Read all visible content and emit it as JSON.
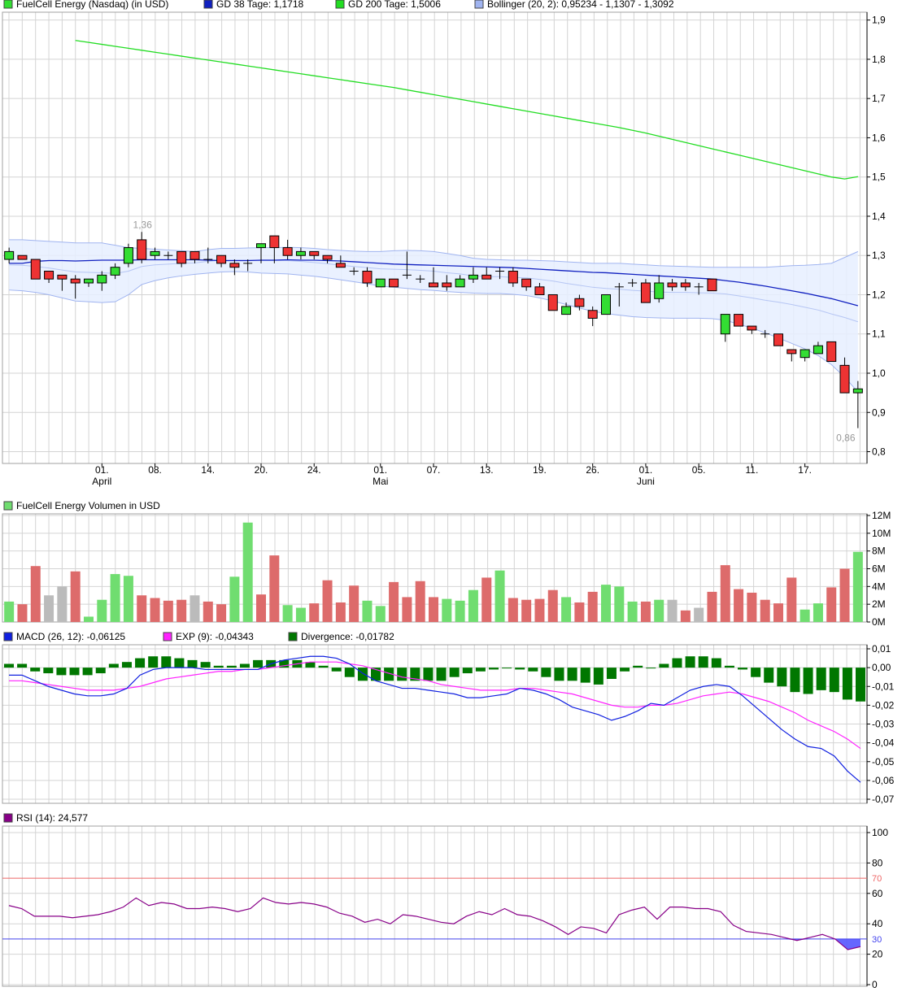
{
  "colors": {
    "grid": "#d4d4d4",
    "frame": "#a0a0a0",
    "up": "#33dd33",
    "down": "#ee3333",
    "gd38": "#1020c0",
    "gd200": "#22dd22",
    "band_fill": "#e6efff",
    "band_line": "#a0b4f0",
    "vol_up": "#70dd70",
    "vol_down": "#dd6b6b",
    "vol_neutral": "#bbbbbb",
    "macd": "#1020e0",
    "exp": "#ff22ff",
    "divergence": "#007700",
    "rsi": "#880088",
    "rsi_70": "#ee6666",
    "rsi_30": "#4444ee",
    "rsi_fill": "#5555ff"
  },
  "chart_data": [
    {
      "id": "price",
      "type": "candlestick",
      "legend": [
        {
          "label": "FuelCell Energy (Nasdaq) (in USD)",
          "color": "#33dd33"
        },
        {
          "label": "GD 38 Tage: 1,1718",
          "color": "#1020c0"
        },
        {
          "label": "GD 200 Tage: 1,5006",
          "color": "#22dd22"
        },
        {
          "label": "Bollinger (20, 2): 0,95234 - 1,1307 - 1,3092",
          "color": "#a0b4f0"
        }
      ],
      "ylim": [
        0.77,
        1.92
      ],
      "y_ticks": [
        "0,8",
        "0,9",
        "1,0",
        "1,1",
        "1,2",
        "1,3",
        "1,4",
        "1,5",
        "1,6",
        "1,7",
        "1,8",
        "1,9"
      ],
      "x_ticks": [
        "01.",
        "08.",
        "14.",
        "20.",
        "24.",
        "01.",
        "07.",
        "13.",
        "19.",
        "26.",
        "01.",
        "05.",
        "11.",
        "17."
      ],
      "x_month_labels": [
        "April",
        "Mai",
        "Juni"
      ],
      "annotations": [
        "1,36",
        "0,86"
      ],
      "candles": [
        [
          1.29,
          1.32,
          1.28,
          1.31
        ],
        [
          1.3,
          1.3,
          1.29,
          1.29
        ],
        [
          1.29,
          1.29,
          1.24,
          1.24
        ],
        [
          1.26,
          1.26,
          1.23,
          1.24
        ],
        [
          1.25,
          1.25,
          1.21,
          1.24
        ],
        [
          1.24,
          1.25,
          1.19,
          1.23
        ],
        [
          1.23,
          1.24,
          1.22,
          1.24
        ],
        [
          1.23,
          1.26,
          1.21,
          1.25
        ],
        [
          1.25,
          1.28,
          1.24,
          1.27
        ],
        [
          1.28,
          1.33,
          1.27,
          1.32
        ],
        [
          1.34,
          1.36,
          1.28,
          1.29
        ],
        [
          1.3,
          1.32,
          1.29,
          1.31
        ],
        [
          1.3,
          1.31,
          1.29,
          1.3
        ],
        [
          1.31,
          1.31,
          1.27,
          1.28
        ],
        [
          1.31,
          1.31,
          1.28,
          1.29
        ],
        [
          1.29,
          1.32,
          1.28,
          1.29
        ],
        [
          1.3,
          1.3,
          1.27,
          1.28
        ],
        [
          1.28,
          1.29,
          1.25,
          1.27
        ],
        [
          1.28,
          1.29,
          1.26,
          1.28
        ],
        [
          1.32,
          1.33,
          1.28,
          1.33
        ],
        [
          1.35,
          1.35,
          1.28,
          1.32
        ],
        [
          1.32,
          1.34,
          1.29,
          1.3
        ],
        [
          1.3,
          1.32,
          1.29,
          1.31
        ],
        [
          1.31,
          1.31,
          1.29,
          1.3
        ],
        [
          1.3,
          1.3,
          1.28,
          1.29
        ],
        [
          1.28,
          1.3,
          1.27,
          1.27
        ],
        [
          1.26,
          1.27,
          1.25,
          1.26
        ],
        [
          1.26,
          1.27,
          1.22,
          1.23
        ],
        [
          1.22,
          1.24,
          1.22,
          1.24
        ],
        [
          1.24,
          1.24,
          1.22,
          1.22
        ],
        [
          1.25,
          1.31,
          1.24,
          1.25
        ],
        [
          1.24,
          1.25,
          1.23,
          1.24
        ],
        [
          1.23,
          1.27,
          1.22,
          1.22
        ],
        [
          1.23,
          1.25,
          1.21,
          1.22
        ],
        [
          1.22,
          1.25,
          1.22,
          1.24
        ],
        [
          1.24,
          1.27,
          1.23,
          1.25
        ],
        [
          1.25,
          1.27,
          1.24,
          1.24
        ],
        [
          1.26,
          1.27,
          1.24,
          1.26
        ],
        [
          1.26,
          1.27,
          1.22,
          1.23
        ],
        [
          1.24,
          1.24,
          1.21,
          1.22
        ],
        [
          1.22,
          1.23,
          1.2,
          1.2
        ],
        [
          1.2,
          1.2,
          1.16,
          1.16
        ],
        [
          1.15,
          1.18,
          1.15,
          1.17
        ],
        [
          1.19,
          1.2,
          1.16,
          1.17
        ],
        [
          1.16,
          1.17,
          1.12,
          1.14
        ],
        [
          1.15,
          1.2,
          1.15,
          1.2
        ],
        [
          1.22,
          1.23,
          1.17,
          1.22
        ],
        [
          1.23,
          1.24,
          1.22,
          1.23
        ],
        [
          1.23,
          1.24,
          1.18,
          1.18
        ],
        [
          1.19,
          1.25,
          1.18,
          1.23
        ],
        [
          1.23,
          1.24,
          1.21,
          1.22
        ],
        [
          1.23,
          1.24,
          1.21,
          1.22
        ],
        [
          1.22,
          1.23,
          1.2,
          1.22
        ],
        [
          1.24,
          1.24,
          1.21,
          1.21
        ],
        [
          1.1,
          1.15,
          1.08,
          1.15
        ],
        [
          1.15,
          1.15,
          1.12,
          1.12
        ],
        [
          1.12,
          1.12,
          1.1,
          1.11
        ],
        [
          1.1,
          1.11,
          1.09,
          1.1
        ],
        [
          1.1,
          1.1,
          1.07,
          1.07
        ],
        [
          1.06,
          1.06,
          1.03,
          1.05
        ],
        [
          1.04,
          1.06,
          1.03,
          1.06
        ],
        [
          1.05,
          1.08,
          1.05,
          1.07
        ],
        [
          1.08,
          1.08,
          1.03,
          1.03
        ],
        [
          1.02,
          1.04,
          0.95,
          0.95
        ],
        [
          0.95,
          0.98,
          0.86,
          0.96
        ]
      ],
      "gd38": [
        1.28,
        1.28,
        1.285,
        1.287,
        1.287,
        1.286,
        1.287,
        1.288,
        1.288,
        1.288,
        1.289,
        1.289,
        1.289,
        1.289,
        1.289,
        1.288,
        1.287,
        1.287,
        1.287,
        1.288,
        1.288,
        1.289,
        1.288,
        1.288,
        1.287,
        1.286,
        1.284,
        1.282,
        1.28,
        1.278,
        1.277,
        1.276,
        1.275,
        1.274,
        1.273,
        1.272,
        1.271,
        1.27,
        1.269,
        1.267,
        1.265,
        1.263,
        1.261,
        1.259,
        1.257,
        1.256,
        1.254,
        1.252,
        1.25,
        1.248,
        1.246,
        1.244,
        1.242,
        1.24,
        1.236,
        1.232,
        1.227,
        1.222,
        1.216,
        1.21,
        1.204,
        1.197,
        1.19,
        1.181,
        1.172
      ],
      "gd200": [
        null,
        null,
        null,
        null,
        null,
        1.848,
        1.843,
        1.838,
        1.833,
        1.828,
        1.823,
        1.818,
        1.813,
        1.808,
        1.803,
        1.798,
        1.793,
        1.788,
        1.783,
        1.778,
        1.773,
        1.768,
        1.763,
        1.758,
        1.753,
        1.748,
        1.743,
        1.738,
        1.733,
        1.728,
        1.722,
        1.716,
        1.71,
        1.704,
        1.698,
        1.692,
        1.686,
        1.68,
        1.674,
        1.668,
        1.662,
        1.656,
        1.65,
        1.644,
        1.638,
        1.632,
        1.626,
        1.619,
        1.612,
        1.604,
        1.596,
        1.588,
        1.58,
        1.572,
        1.564,
        1.556,
        1.548,
        1.54,
        1.532,
        1.524,
        1.516,
        1.508,
        1.5,
        1.495,
        1.501
      ],
      "boll_upper": [
        1.34,
        1.34,
        1.338,
        1.336,
        1.334,
        1.332,
        1.332,
        1.332,
        1.326,
        1.32,
        1.318,
        1.316,
        1.314,
        1.312,
        1.31,
        1.315,
        1.318,
        1.318,
        1.319,
        1.32,
        1.32,
        1.321,
        1.32,
        1.318,
        1.315,
        1.313,
        1.311,
        1.31,
        1.31,
        1.312,
        1.313,
        1.312,
        1.31,
        1.305,
        1.3,
        1.293,
        1.29,
        1.289,
        1.288,
        1.288,
        1.287,
        1.286,
        1.284,
        1.282,
        1.28,
        1.28,
        1.28,
        1.278,
        1.276,
        1.274,
        1.273,
        1.272,
        1.271,
        1.27,
        1.27,
        1.27,
        1.27,
        1.27,
        1.272,
        1.274,
        1.275,
        1.277,
        1.28,
        1.295,
        1.31
      ],
      "boll_lower": [
        1.212,
        1.21,
        1.206,
        1.2,
        1.192,
        1.184,
        1.182,
        1.18,
        1.182,
        1.2,
        1.226,
        1.236,
        1.243,
        1.248,
        1.252,
        1.255,
        1.258,
        1.259,
        1.258,
        1.255,
        1.254,
        1.253,
        1.25,
        1.247,
        1.243,
        1.238,
        1.233,
        1.228,
        1.222,
        1.219,
        1.216,
        1.213,
        1.211,
        1.208,
        1.206,
        1.204,
        1.203,
        1.203,
        1.201,
        1.198,
        1.192,
        1.184,
        1.175,
        1.166,
        1.158,
        1.152,
        1.148,
        1.144,
        1.142,
        1.141,
        1.14,
        1.14,
        1.14,
        1.139,
        1.135,
        1.125,
        1.115,
        1.103,
        1.09,
        1.076,
        1.062,
        1.045,
        1.022,
        0.99,
        0.952
      ],
      "boll_middle": [
        1.276,
        1.275,
        1.272,
        1.268,
        1.263,
        1.258,
        1.257,
        1.256,
        1.254,
        1.26,
        1.272,
        1.276,
        1.278,
        1.28,
        1.281,
        1.285,
        1.288,
        1.288,
        1.288,
        1.287,
        1.287,
        1.287,
        1.285,
        1.282,
        1.279,
        1.275,
        1.272,
        1.269,
        1.266,
        1.265,
        1.264,
        1.262,
        1.26,
        1.256,
        1.253,
        1.248,
        1.246,
        1.246,
        1.244,
        1.243,
        1.239,
        1.235,
        1.229,
        1.224,
        1.219,
        1.216,
        1.214,
        1.211,
        1.209,
        1.207,
        1.206,
        1.206,
        1.205,
        1.204,
        1.202,
        1.197,
        1.192,
        1.186,
        1.181,
        1.175,
        1.168,
        1.161,
        1.151,
        1.142,
        1.131
      ]
    },
    {
      "id": "volume",
      "type": "bar",
      "legend": [
        {
          "label": "FuelCell Energy Volumen in USD",
          "color": "#70dd70"
        }
      ],
      "ylim": [
        0,
        12
      ],
      "y_ticks": [
        "0M",
        "2M",
        "4M",
        "6M",
        "8M",
        "10M",
        "12M"
      ],
      "values": [
        2.3,
        2.0,
        6.3,
        3.0,
        4.0,
        5.7,
        0.6,
        2.5,
        5.4,
        5.2,
        3.0,
        2.7,
        2.4,
        2.5,
        3.0,
        2.3,
        2.0,
        5.1,
        11.2,
        3.1,
        7.5,
        1.9,
        1.6,
        2.1,
        4.7,
        2.2,
        4.1,
        2.4,
        1.8,
        4.5,
        2.8,
        4.6,
        2.8,
        2.6,
        2.4,
        3.6,
        5.0,
        5.8,
        2.7,
        2.5,
        2.6,
        3.6,
        2.8,
        2.2,
        3.4,
        4.2,
        4.0,
        2.3,
        2.3,
        2.5,
        2.5,
        1.3,
        1.6,
        3.4,
        6.4,
        3.7,
        3.3,
        2.5,
        2.1,
        5.0,
        1.4,
        2.1,
        3.9,
        6.0,
        7.9
      ],
      "kinds": [
        "u",
        "d",
        "d",
        "n",
        "n",
        "d",
        "u",
        "u",
        "u",
        "u",
        "d",
        "d",
        "d",
        "d",
        "n",
        "d",
        "d",
        "u",
        "u",
        "d",
        "d",
        "u",
        "u",
        "d",
        "d",
        "d",
        "d",
        "u",
        "u",
        "d",
        "d",
        "d",
        "d",
        "u",
        "u",
        "u",
        "d",
        "u",
        "d",
        "d",
        "d",
        "d",
        "u",
        "d",
        "d",
        "u",
        "u",
        "u",
        "d",
        "u",
        "n",
        "d",
        "n",
        "d",
        "d",
        "d",
        "d",
        "d",
        "d",
        "d",
        "u",
        "u",
        "d",
        "d",
        "u"
      ]
    },
    {
      "id": "macd",
      "type": "line",
      "legend": [
        {
          "label": "MACD (26, 12): -0,06125",
          "color": "#1020e0"
        },
        {
          "label": "EXP (9): -0,04343",
          "color": "#ff22ff"
        },
        {
          "label": "Divergence: -0,01782",
          "color": "#007700"
        }
      ],
      "ylim": [
        -0.07,
        0.01
      ],
      "y_ticks": [
        "-0,07",
        "-0,06",
        "-0,05",
        "-0,04",
        "-0,03",
        "-0,02",
        "-0,01",
        "0,00",
        "0,01"
      ],
      "macd": [
        -0.004,
        -0.004,
        -0.007,
        -0.01,
        -0.012,
        -0.014,
        -0.015,
        -0.015,
        -0.014,
        -0.011,
        -0.004,
        -0.001,
        0.0,
        0.0,
        0.0,
        -0.001,
        -0.001,
        -0.001,
        -0.001,
        -0.001,
        0.002,
        0.004,
        0.005,
        0.006,
        0.006,
        0.005,
        0.002,
        -0.003,
        -0.007,
        -0.009,
        -0.011,
        -0.011,
        -0.012,
        -0.013,
        -0.014,
        -0.016,
        -0.016,
        -0.015,
        -0.014,
        -0.011,
        -0.012,
        -0.014,
        -0.017,
        -0.021,
        -0.023,
        -0.025,
        -0.028,
        -0.026,
        -0.023,
        -0.019,
        -0.02,
        -0.016,
        -0.012,
        -0.01,
        -0.009,
        -0.01,
        -0.015,
        -0.021,
        -0.027,
        -0.033,
        -0.038,
        -0.042,
        -0.043,
        -0.047,
        -0.055,
        -0.061
      ],
      "exp": [
        -0.007,
        -0.007,
        -0.008,
        -0.009,
        -0.01,
        -0.011,
        -0.012,
        -0.012,
        -0.012,
        -0.011,
        -0.01,
        -0.008,
        -0.006,
        -0.005,
        -0.004,
        -0.003,
        -0.002,
        -0.002,
        -0.001,
        -0.001,
        0.0,
        0.001,
        0.002,
        0.003,
        0.003,
        0.003,
        0.002,
        0.001,
        -0.001,
        -0.003,
        -0.005,
        -0.006,
        -0.007,
        -0.009,
        -0.01,
        -0.011,
        -0.012,
        -0.012,
        -0.012,
        -0.011,
        -0.011,
        -0.012,
        -0.013,
        -0.014,
        -0.016,
        -0.018,
        -0.02,
        -0.021,
        -0.021,
        -0.02,
        -0.02,
        -0.019,
        -0.017,
        -0.015,
        -0.014,
        -0.013,
        -0.014,
        -0.016,
        -0.018,
        -0.021,
        -0.024,
        -0.028,
        -0.031,
        -0.034,
        -0.038,
        -0.043
      ],
      "divergence": [
        0.002,
        0.002,
        -0.002,
        -0.003,
        -0.004,
        -0.004,
        -0.004,
        -0.003,
        0.002,
        0.003,
        0.005,
        0.006,
        0.006,
        0.005,
        0.004,
        0.003,
        0.001,
        0.001,
        0.002,
        0.004,
        0.004,
        0.004,
        0.004,
        0.003,
        0.001,
        -0.002,
        -0.005,
        -0.007,
        -0.007,
        -0.007,
        -0.007,
        -0.007,
        -0.007,
        -0.007,
        -0.005,
        -0.003,
        -0.002,
        -0.001,
        0.0,
        -0.001,
        -0.002,
        -0.005,
        -0.007,
        -0.007,
        -0.008,
        -0.009,
        -0.006,
        -0.002,
        0.001,
        0.0,
        0.002,
        0.005,
        0.006,
        0.006,
        0.005,
        0.001,
        -0.001,
        -0.005,
        -0.008,
        -0.01,
        -0.013,
        -0.014,
        -0.012,
        -0.013,
        -0.017,
        -0.018
      ]
    },
    {
      "id": "rsi",
      "type": "line",
      "legend": [
        {
          "label": "RSI (14): 24,577",
          "color": "#880088"
        }
      ],
      "ylim": [
        0,
        100
      ],
      "y_ticks": [
        "0",
        "20",
        "40",
        "60",
        "80",
        "100"
      ],
      "levels": [
        70,
        30
      ],
      "level_labels": [
        "70",
        "30"
      ],
      "values": [
        52,
        50,
        45,
        45,
        45,
        44,
        45,
        46,
        48,
        51,
        57,
        52,
        54,
        53,
        50,
        50,
        51,
        50,
        48,
        50,
        57,
        54,
        53,
        54,
        53,
        51,
        47,
        45,
        41,
        43,
        40,
        46,
        45,
        43,
        41,
        40,
        45,
        48,
        46,
        50,
        46,
        45,
        42,
        38,
        33,
        38,
        37,
        34,
        46,
        49,
        51,
        43,
        51,
        51,
        50,
        50,
        48,
        39,
        35,
        34,
        33,
        31,
        29,
        31,
        33,
        30,
        23,
        25
      ]
    }
  ]
}
